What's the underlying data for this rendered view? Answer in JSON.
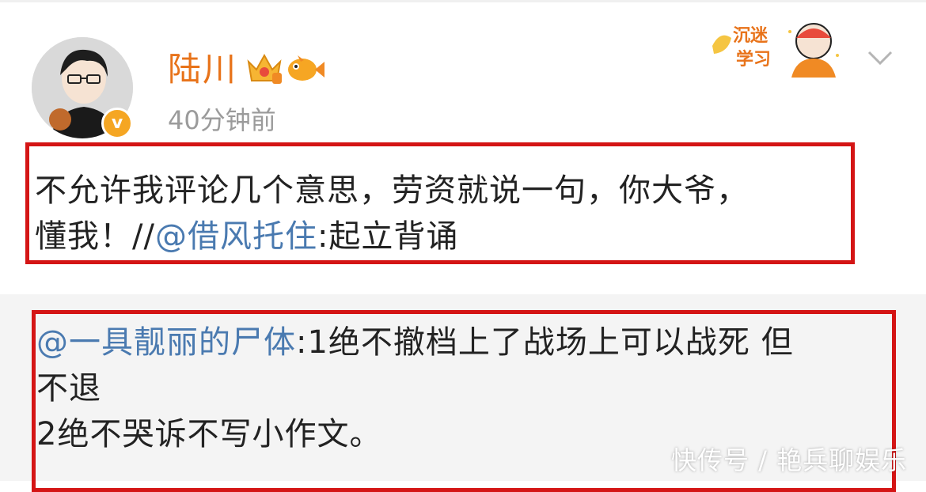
{
  "post": {
    "username": "陆川",
    "timestamp": "40分钟前",
    "verified_badge": "v",
    "icons": [
      "crown-icon",
      "fish-icon",
      "chevron-down-icon"
    ],
    "sticker_text": "沉迷学习",
    "content_line1": "不允许我评论几个意思，劳资就说一句，你大爷，",
    "content_line2_a": "懂我！//",
    "content_mention": "@借风托住",
    "content_line2_b": ":起立背诵"
  },
  "quoted": {
    "mention": "@一具靓丽的尸体",
    "line1_rest": ":1绝不撤档上了战场上可以战死 但",
    "line2": "不退",
    "line3": "2绝不哭诉不写小作文。"
  },
  "watermark": "快传号 / 艳兵聊娱乐",
  "colors": {
    "username": "#e8731a",
    "link": "#4a7ab0",
    "highlight_box": "#d41515",
    "timestamp": "#9b9b9b",
    "quoted_bg": "#f4f4f4"
  }
}
